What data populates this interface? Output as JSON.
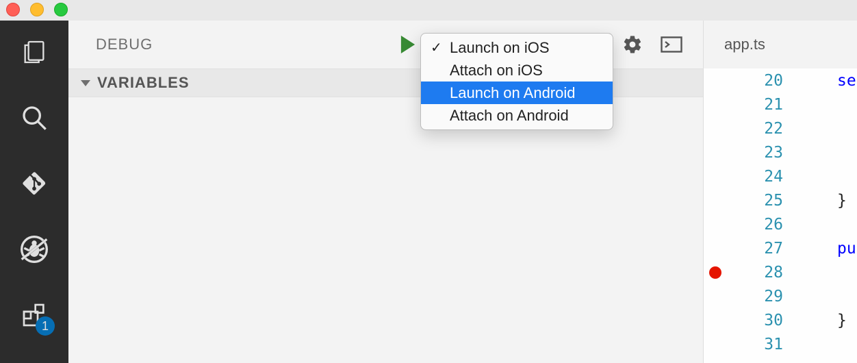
{
  "traffic_lights": [
    "close",
    "minimize",
    "zoom"
  ],
  "activity_bar": {
    "items": [
      {
        "name": "explorer-icon"
      },
      {
        "name": "search-icon"
      },
      {
        "name": "git-icon"
      },
      {
        "name": "debug-icon"
      },
      {
        "name": "extensions-icon",
        "badge": "1"
      }
    ]
  },
  "sidebar": {
    "title": "DEBUG",
    "actions": {
      "play": "start-debug",
      "gear": "configure",
      "console": "debug-console"
    },
    "section": {
      "label": "VARIABLES"
    }
  },
  "dropdown": {
    "items": [
      {
        "label": "Launch on iOS",
        "checked": true,
        "highlight": false
      },
      {
        "label": "Attach on iOS",
        "checked": false,
        "highlight": false
      },
      {
        "label": "Launch on Android",
        "checked": false,
        "highlight": true
      },
      {
        "label": "Attach on Android",
        "checked": false,
        "highlight": false
      }
    ]
  },
  "editor": {
    "tab": "app.ts",
    "lines": [
      {
        "n": "20",
        "bp": false,
        "code": "set",
        "cls": "tok-kw"
      },
      {
        "n": "21",
        "bp": false,
        "code": "",
        "cls": ""
      },
      {
        "n": "22",
        "bp": false,
        "code": "",
        "cls": ""
      },
      {
        "n": "23",
        "bp": false,
        "code": "",
        "cls": ""
      },
      {
        "n": "24",
        "bp": false,
        "code": "",
        "cls": ""
      },
      {
        "n": "25",
        "bp": false,
        "code": "}",
        "cls": "tok-text"
      },
      {
        "n": "26",
        "bp": false,
        "code": "",
        "cls": ""
      },
      {
        "n": "27",
        "bp": false,
        "code": "pub",
        "cls": "tok-kw"
      },
      {
        "n": "28",
        "bp": true,
        "code": "",
        "cls": ""
      },
      {
        "n": "29",
        "bp": false,
        "code": "",
        "cls": ""
      },
      {
        "n": "30",
        "bp": false,
        "code": "}",
        "cls": "tok-text"
      },
      {
        "n": "31",
        "bp": false,
        "code": "",
        "cls": ""
      }
    ]
  }
}
